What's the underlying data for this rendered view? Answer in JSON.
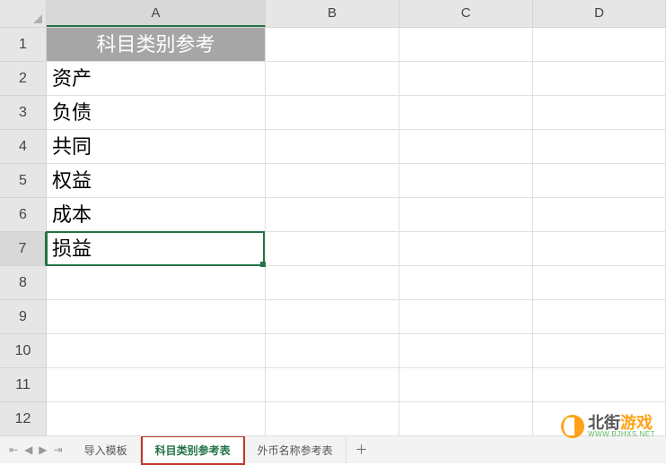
{
  "columns": [
    "A",
    "B",
    "C",
    "D"
  ],
  "rows": [
    "1",
    "2",
    "3",
    "4",
    "5",
    "6",
    "7",
    "8",
    "9",
    "10",
    "11",
    "12"
  ],
  "active_row": "7",
  "active_col": "A",
  "header_cell": "科目类别参考",
  "data_cells": [
    "资产",
    "负债",
    "共同",
    "权益",
    "成本",
    "损益"
  ],
  "tabs": {
    "nav_first": "⇤",
    "nav_prev": "◀",
    "nav_next": "▶",
    "nav_last": "⇥",
    "items": [
      {
        "label": "导入模板",
        "active": false
      },
      {
        "label": "科目类别参考表",
        "active": true
      },
      {
        "label": "外币名称参考表",
        "active": false
      }
    ],
    "add": "＋"
  },
  "watermark": {
    "main1": "北街",
    "main2": "游戏",
    "sub": "WWW.BJHXS.NET"
  },
  "chart_data": {
    "type": "table",
    "title": "科目类别参考",
    "categories": [
      "科目类别"
    ],
    "values": [
      "资产",
      "负债",
      "共同",
      "权益",
      "成本",
      "损益"
    ]
  }
}
